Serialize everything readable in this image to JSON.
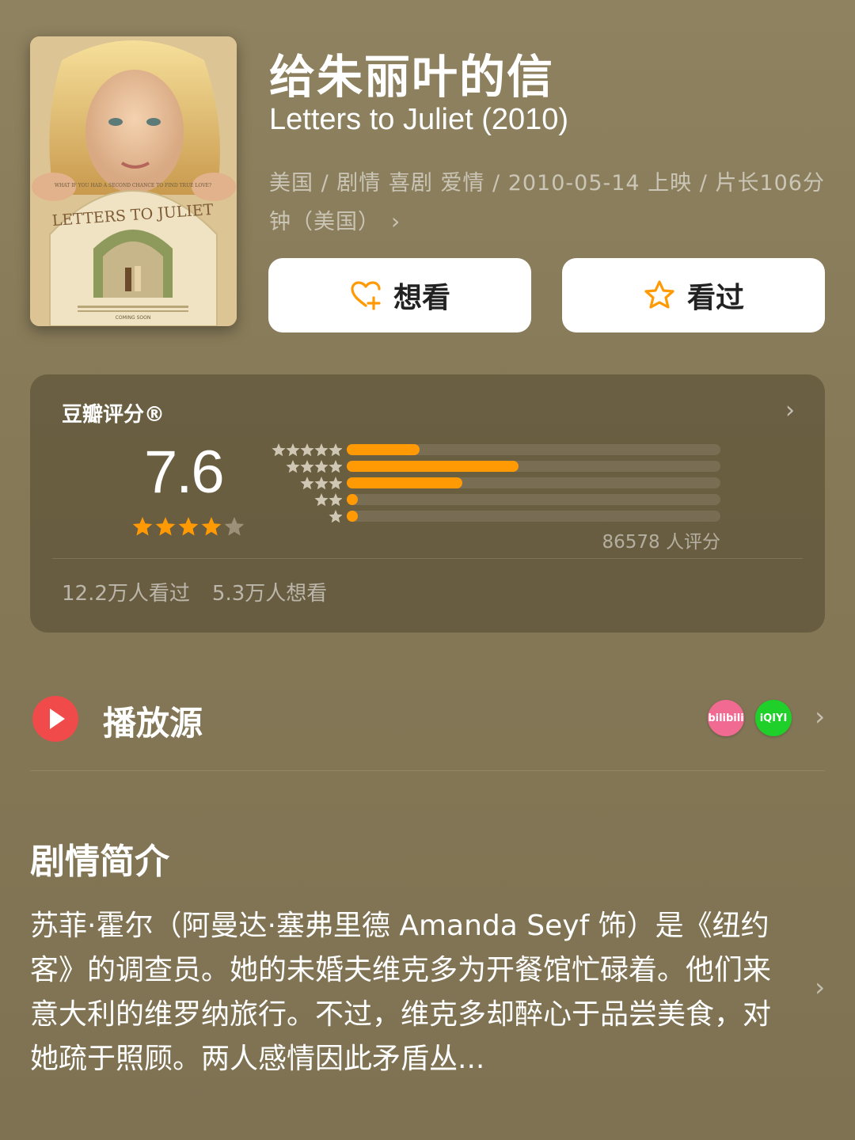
{
  "movie": {
    "title_cn": "给朱丽叶的信",
    "title_en": "Letters to Juliet (2010)",
    "meta_line": "美国 / 剧情 喜剧 爱情 / 2010-05-14 上映 / 片长106分钟（美国）",
    "meta_chevron": "›",
    "poster": {
      "title_text": "LETTERS TO JULIET",
      "tagline": "WHAT IF YOU HAD A SECOND CHANCE TO FIND TRUE LOVE?",
      "footer": "COMING SOON"
    }
  },
  "actions": {
    "want_label": "想看",
    "seen_label": "看过",
    "icon_color": "#ff9a05"
  },
  "rating": {
    "label": "豆瓣评分®",
    "score": "7.6",
    "star_rating": 4,
    "star_max": 5,
    "distribution_fraction": [
      0.195,
      0.46,
      0.31,
      0.03,
      0.03
    ],
    "count_text": "86578 人评分",
    "seen_text": "12.2万人看过",
    "want_text": "5.3万人想看",
    "chevron": "›"
  },
  "play_source": {
    "title": "播放源",
    "sources": [
      {
        "name": "bilibili",
        "label": "bilibili",
        "color": "#f06a92"
      },
      {
        "name": "iqiyi",
        "label": "iQIYI",
        "color": "#1fcf2a"
      }
    ],
    "chevron": "›"
  },
  "synopsis": {
    "title": "剧情简介",
    "text": "苏菲·霍尔（阿曼达·塞弗里德 Amanda Seyf 饰）是《纽约客》的调查员。她的未婚夫维克多为开餐馆忙碌着。他们来意大利的维罗纳旅行。不过，维克多却醉心于品尝美食，对她疏于照顾。两人感情因此矛盾丛...",
    "chevron": "›"
  },
  "colors": {
    "accent": "#ff9a05",
    "background": "#857957",
    "star_filled": "#ff9a05",
    "star_empty": "#9b9178"
  }
}
